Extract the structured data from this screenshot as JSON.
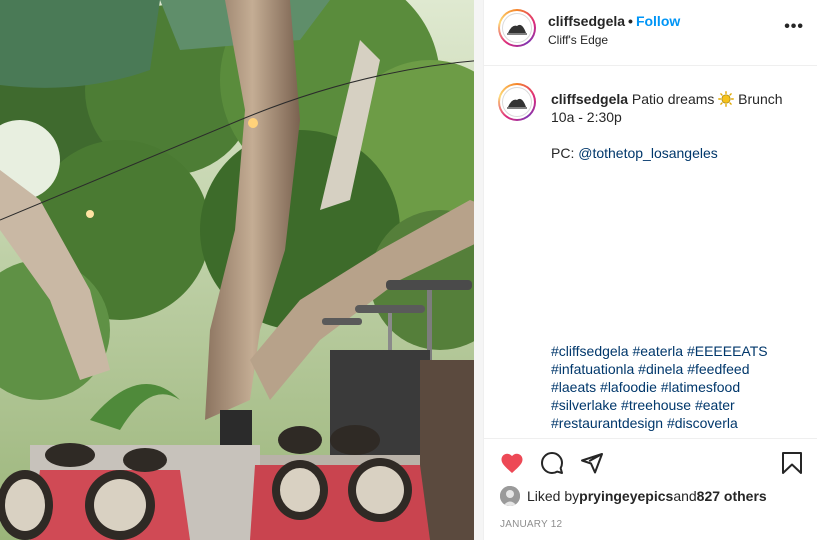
{
  "header": {
    "username": "cliffsedgela",
    "separator": "•",
    "follow_label": "Follow",
    "location": "Cliff's Edge",
    "more_label": "•••"
  },
  "caption": {
    "username": "cliffsedgela",
    "text_before_icon": " Patio dreams ",
    "icon": "sun-emoji-icon",
    "text_after_icon": " Brunch\n10a - 2:30p\n\nPC: ",
    "mention": "@tothetop_losangeles",
    "hashtag_lines": [
      "#cliffsedgela #eaterla #EEEEEATS",
      "#infatuationla #dinela #feedfeed",
      "#laeats #lafoodie #latimesfood",
      "#silverlake #treehouse #eater",
      "#restaurantdesign #discoverla"
    ]
  },
  "actions": {
    "like_icon": "heart-filled-icon",
    "comment_icon": "comment-bubble-icon",
    "share_icon": "paper-plane-icon",
    "save_icon": "bookmark-icon",
    "liked_by_prefix": "Liked by ",
    "liked_by_user": "pryingeyepics",
    "liked_by_and": " and ",
    "liked_by_count": "827 others",
    "date": "JANUARY 12"
  },
  "colors": {
    "accent": "#0095f6",
    "heart": "#ed4956",
    "link": "#00376b",
    "muted": "#8e8e8e"
  }
}
